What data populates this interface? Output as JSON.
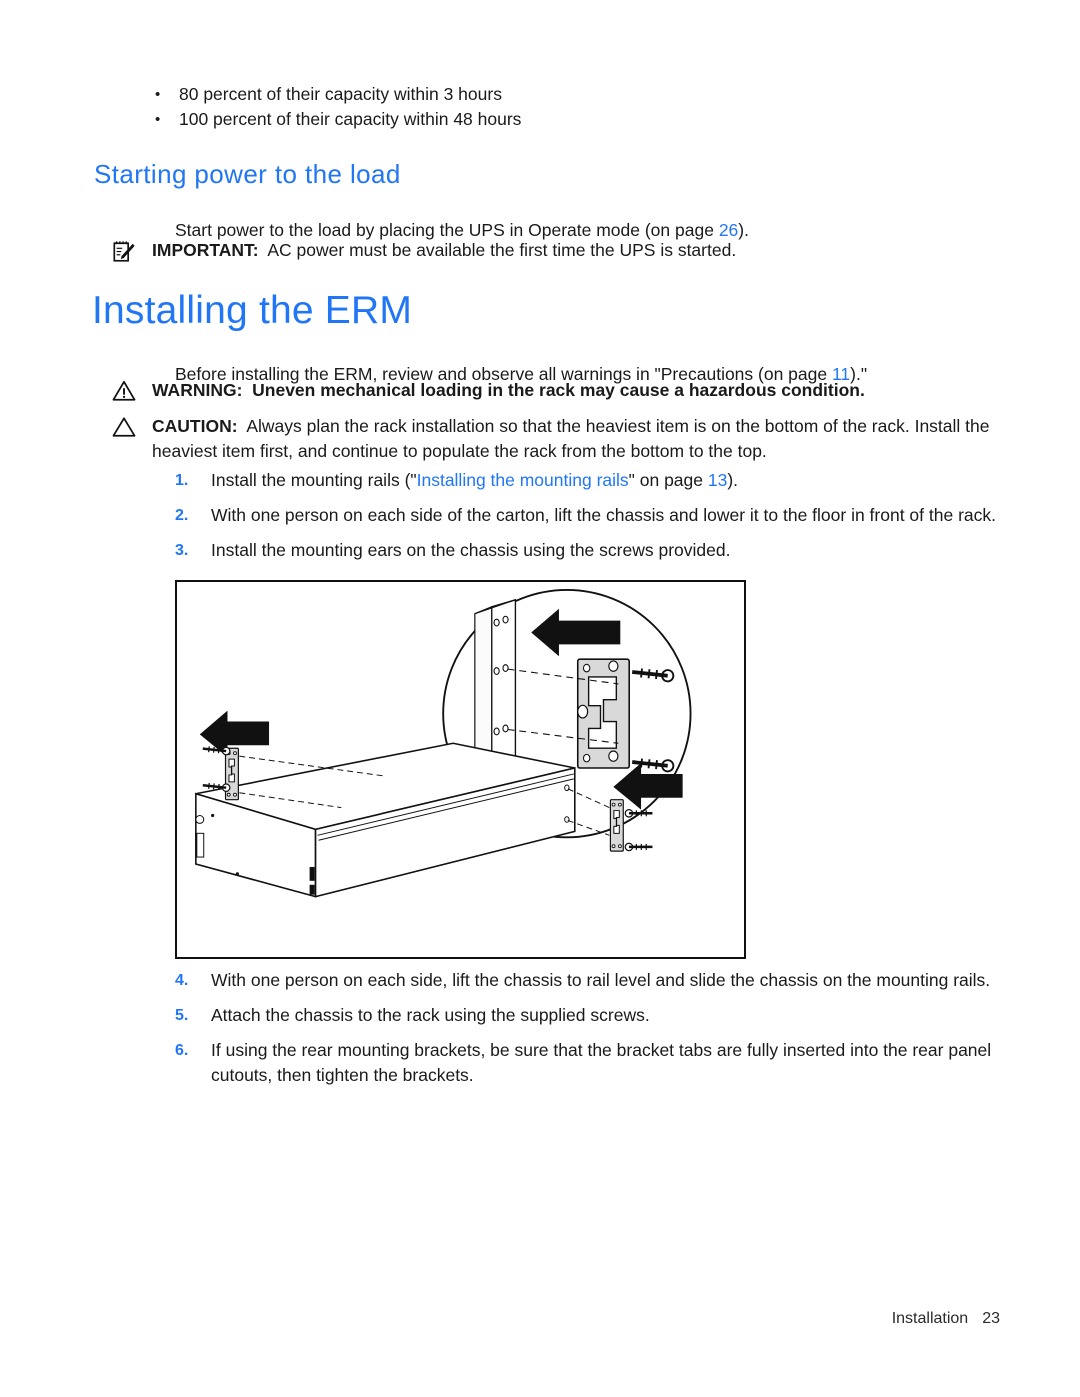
{
  "document": {
    "bullets": [
      "80 percent of their capacity within 3 hours",
      "100 percent of their capacity within 48 hours"
    ],
    "section_heading": "Starting power to the load",
    "start_power_paragraph": {
      "before": "Start power to the load by placing the UPS in Operate mode (on page ",
      "page_ref": "26",
      "after": ")."
    },
    "important_note": {
      "icon": "note-pencil-icon",
      "label": "IMPORTANT:",
      "text": "AC power must be available the first time the UPS is started."
    },
    "chapter_heading": "Installing the ERM",
    "before_paragraph": {
      "before": "Before installing the ERM, review and observe all warnings in \"Precautions (on page ",
      "page_ref": "11",
      "after": ")."
    },
    "warning_note": {
      "icon": "warning-triangle-icon",
      "label": "WARNING:",
      "text": "Uneven mechanical loading in the rack may cause a hazardous condition."
    },
    "caution_note": {
      "icon": "caution-triangle-icon",
      "label": "CAUTION:",
      "text": "Always plan the rack installation so that the heaviest item is on the bottom of the rack. Install the heaviest item first, and continue to populate the rack from the bottom to the top."
    },
    "steps_top": [
      {
        "number": "1.",
        "before": "Install the mounting rails (\"",
        "link": "Installing the mounting rails",
        "middle": "\" on page ",
        "page_ref": "13",
        "after": ")."
      },
      {
        "number": "2.",
        "text": "With one person on each side of the carton, lift the chassis and lower it to the floor in front of the rack."
      },
      {
        "number": "3.",
        "text": "Install the mounting ears on the chassis using the screws provided."
      }
    ],
    "figure": {
      "name": "erm-chassis-mounting-ears-illustration",
      "description": "Isometric line drawing of the ERM chassis with mounting ears, screws and arrows, plus a magnified circular detail of the mounting ear and rail"
    },
    "steps_bottom": [
      {
        "number": "4.",
        "text": "With one person on each side, lift the chassis to rail level and slide the chassis on the mounting rails."
      },
      {
        "number": "5.",
        "text": "Attach the chassis to the rack using the supplied screws."
      },
      {
        "number": "6.",
        "text": "If using the rear mounting brackets, be sure that the bracket tabs are fully inserted into the rear panel cutouts, then tighten the brackets."
      }
    ],
    "footer": {
      "chapter": "Installation",
      "page": "23"
    },
    "colors": {
      "heading_blue": "#2176f5",
      "link_blue": "#2176f5",
      "body_text": "#1a1a1a",
      "figure_border": "#111111",
      "metal_fill": "#d9d9d9"
    }
  }
}
